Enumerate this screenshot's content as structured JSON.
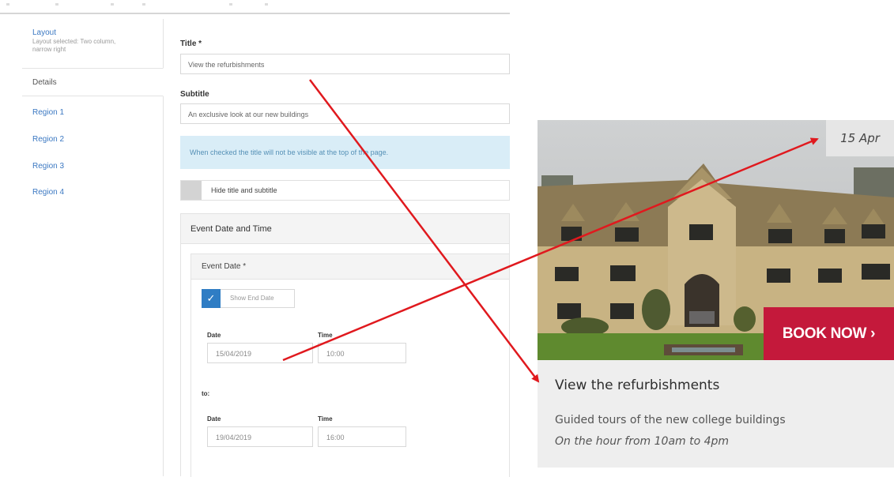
{
  "sidebar": {
    "layout_label": "Layout",
    "layout_sub": "Layout selected: Two column, narrow right",
    "details": "Details",
    "regions": [
      "Region 1",
      "Region 2",
      "Region 3",
      "Region 4"
    ]
  },
  "form": {
    "title_label": "Title *",
    "title_value": "View the refurbishments",
    "subtitle_label": "Subtitle",
    "subtitle_value": "An exclusive look at our new buildings",
    "notice": "When checked the title will not be visible at the top of the page.",
    "hide_label": "Hide title and subtitle",
    "event_panel": "Event Date and Time",
    "event_date_panel": "Event Date *",
    "show_end_date": "Show End Date",
    "start": {
      "date_label": "Date",
      "time_label": "Time",
      "date": "15/04/2019",
      "time": "10:00"
    },
    "to_label": "to:",
    "end": {
      "date_label": "Date",
      "time_label": "Time",
      "date": "19/04/2019",
      "time": "16:00"
    }
  },
  "card": {
    "date_badge": "15 Apr",
    "book_now": "BOOK NOW",
    "title": "View the refurbishments",
    "subtitle": "Guided tours of the new college buildings",
    "time_note": "On the hour from 10am to 4pm"
  },
  "colors": {
    "link_blue": "#3b78c2",
    "notice_bg": "#d9edf7",
    "checkbox_blue": "#2f7dc4",
    "book_red": "#c4193b",
    "arrow_red": "#e0191e"
  },
  "icons": {
    "checkmark": "check-icon",
    "book_chevron": "chevron-right-icon"
  }
}
